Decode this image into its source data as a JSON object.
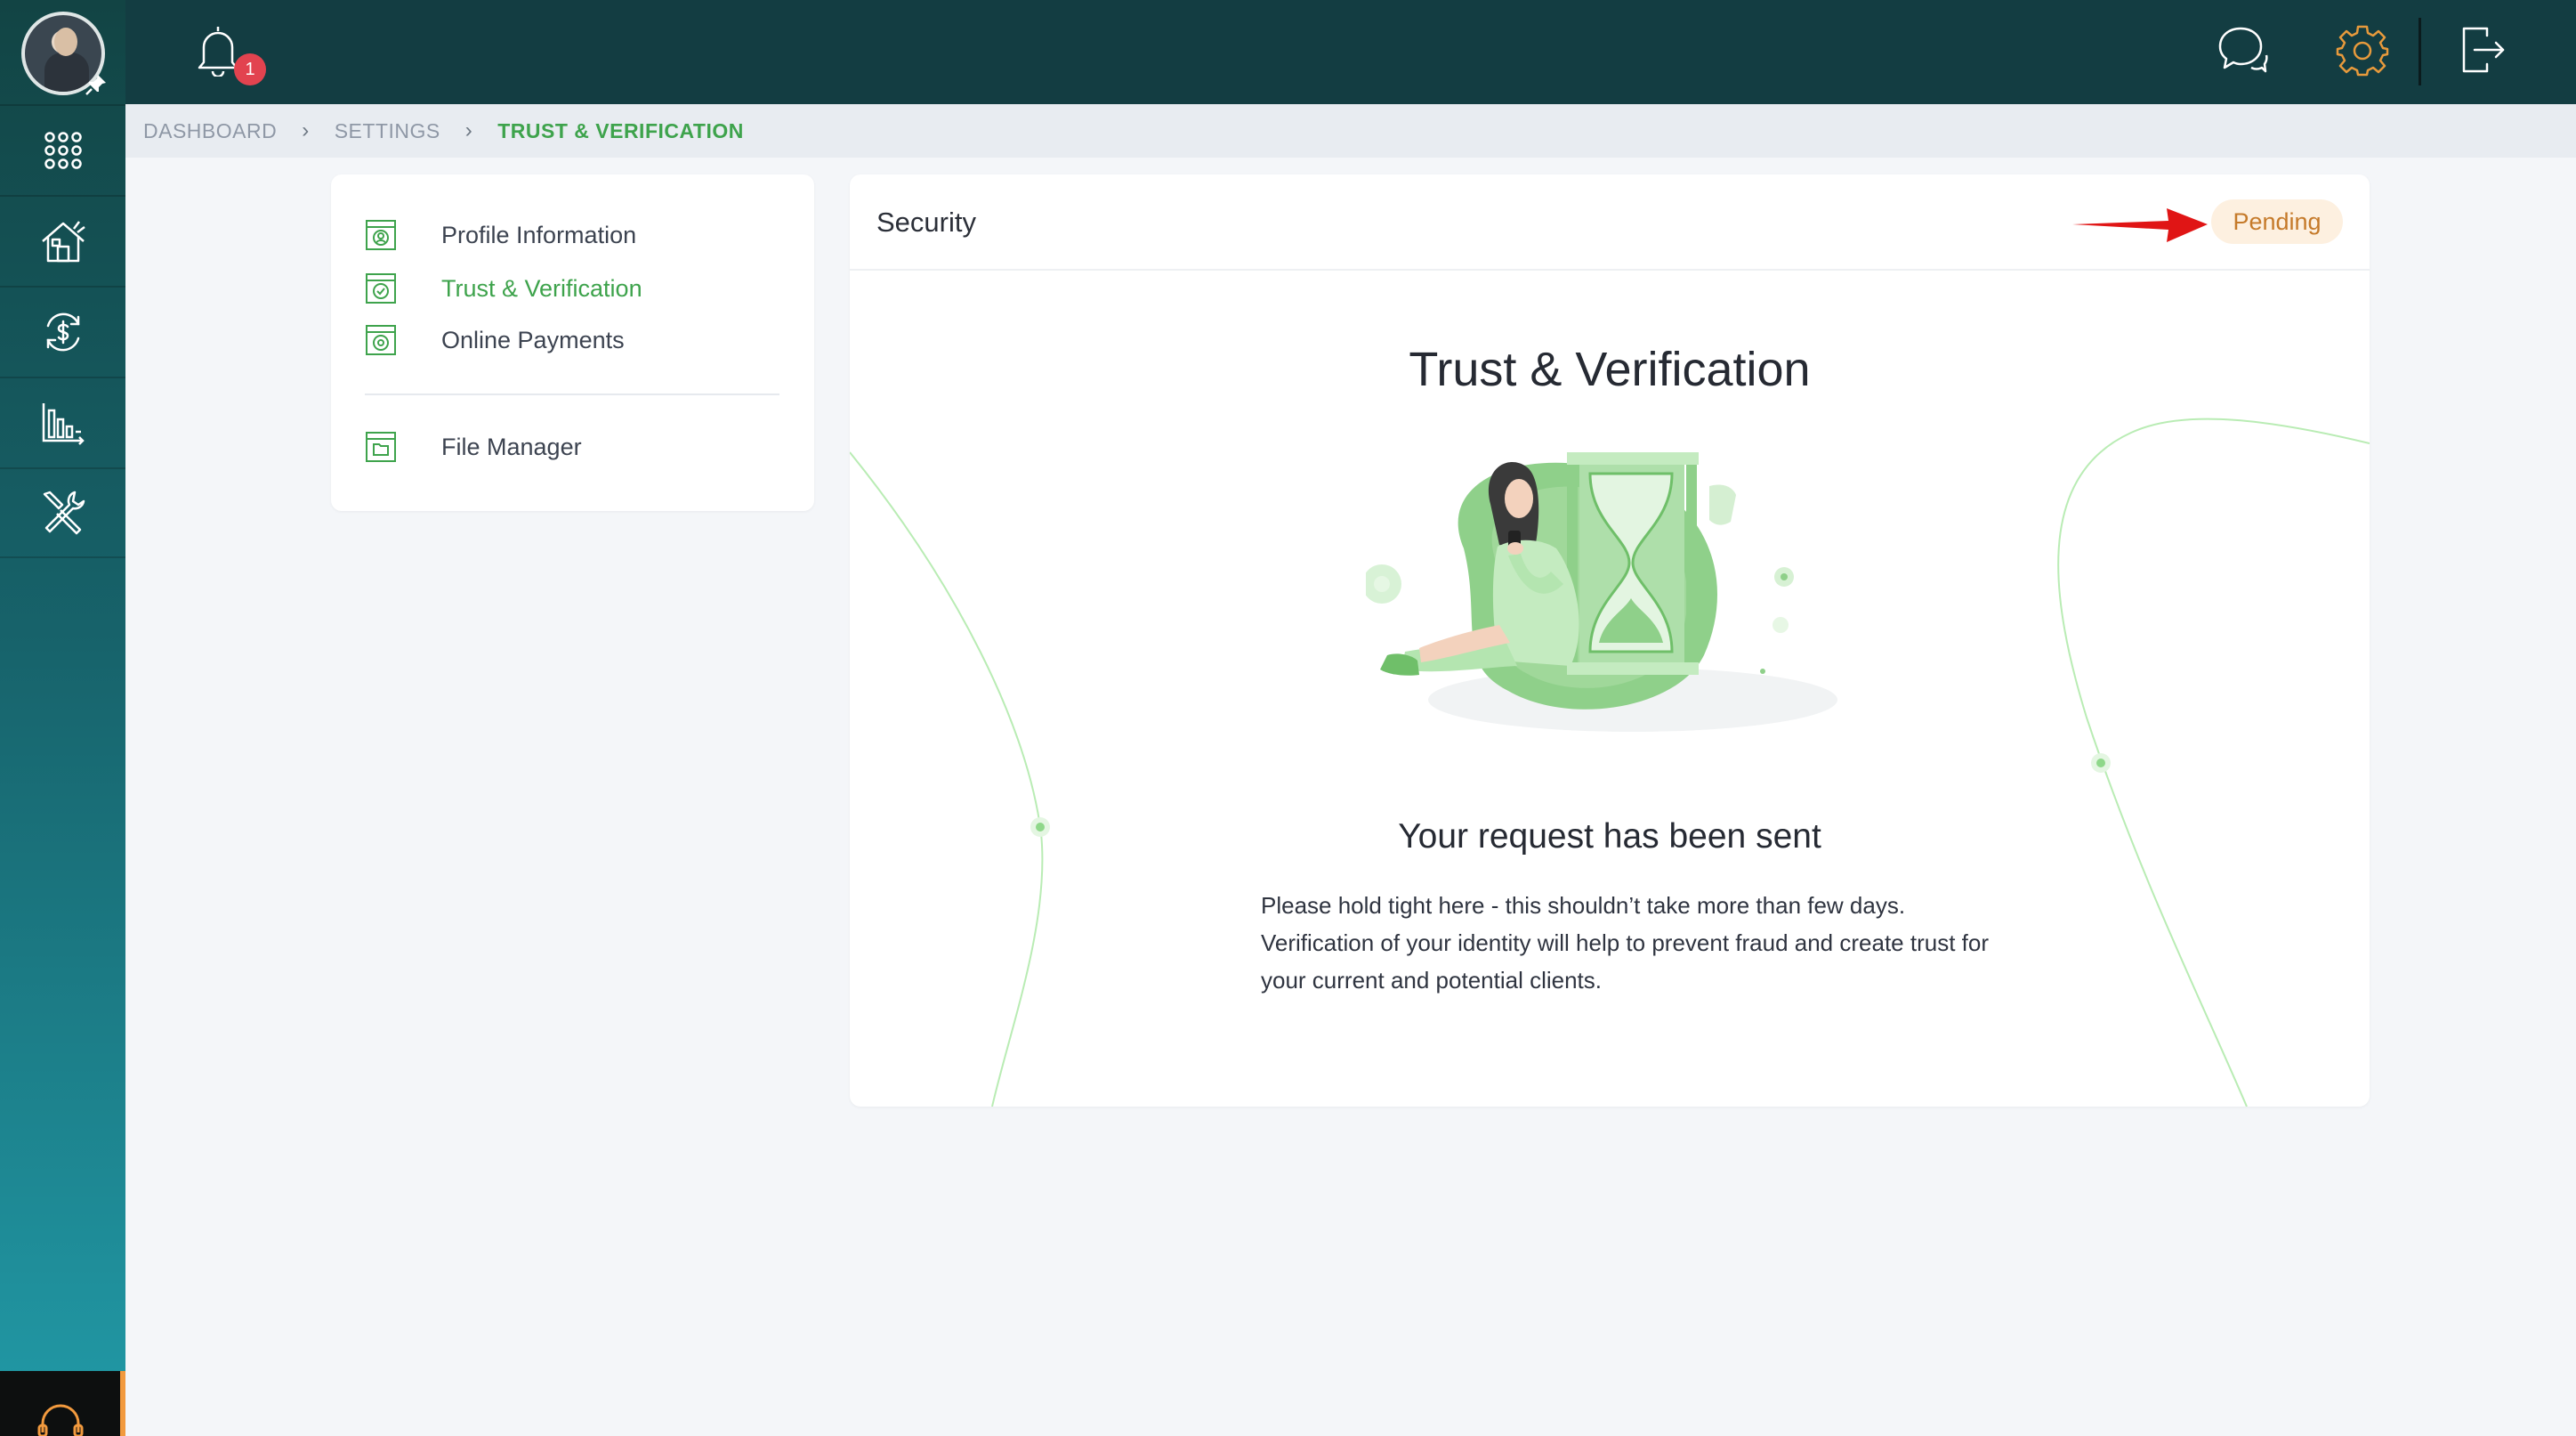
{
  "header": {
    "notification_count": "1"
  },
  "breadcrumb": {
    "items": [
      "DASHBOARD",
      "SETTINGS",
      "TRUST & VERIFICATION"
    ]
  },
  "settings_menu": {
    "items": [
      {
        "label": "Profile Information",
        "icon": "profile-icon"
      },
      {
        "label": "Trust & Verification",
        "icon": "verified-icon"
      },
      {
        "label": "Online Payments",
        "icon": "payments-icon"
      },
      {
        "label": "File Manager",
        "icon": "folder-icon"
      }
    ]
  },
  "main": {
    "section_title": "Security",
    "status": "Pending",
    "heading": "Trust & Verification",
    "subheading": "Your request has been sent",
    "description": "Please hold tight here - this shouldn’t take more than few days. Verification of your identity will help to prevent fraud and create trust for your current and potential clients."
  },
  "colors": {
    "topbar": "#133d42",
    "accent_green": "#3ea34c",
    "pending_text": "#c57a2a",
    "pending_bg": "#fdf0e0",
    "badge_red": "#e2434f",
    "gear_orange": "#e79a3c"
  }
}
